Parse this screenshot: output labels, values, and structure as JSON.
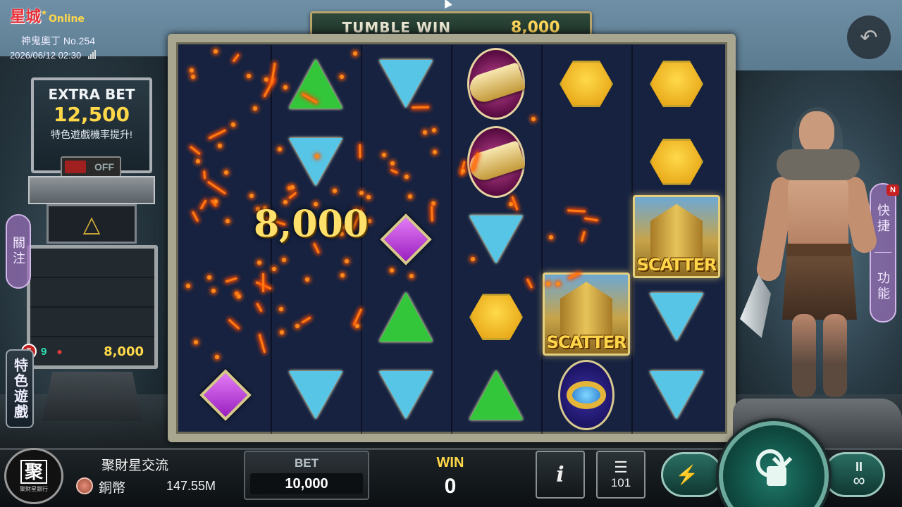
{
  "brand": {
    "logo_text": "星城",
    "online_text": "Online"
  },
  "game": {
    "name": "神鬼奧丁 No.254",
    "datetime": "2026/06/12  02:30"
  },
  "tumble": {
    "label": "TUMBLE WIN",
    "value": "8,000"
  },
  "win_amount_overlay": "8,000",
  "extra_bet": {
    "title": "EXTRA BET",
    "value": "12,500",
    "desc": "特色遊戲機率提升!",
    "toggle": "OFF"
  },
  "free_game": {
    "badge": "5",
    "count": "9",
    "value": "8,000"
  },
  "side_tabs": {
    "left": "關注",
    "special": "特色遊戲",
    "right_top": "快捷",
    "right_bottom": "功能",
    "new_badge": "N"
  },
  "reels": {
    "columns": [
      [
        "empty",
        "empty",
        "empty",
        "empty",
        "gem-purple"
      ],
      [
        "tri-green",
        "tri-blue",
        "empty",
        "empty",
        "tri-blue"
      ],
      [
        "tri-blue",
        "empty",
        "gem-purple",
        "tri-green",
        "tri-blue"
      ],
      [
        "horn",
        "horn",
        "tri-blue",
        "hex-gold",
        "tri-green"
      ],
      [
        "hex-gold",
        "empty",
        "empty",
        "scatter",
        "ring"
      ],
      [
        "hex-gold",
        "hex-gold",
        "scatter",
        "tri-blue",
        "tri-blue"
      ]
    ],
    "scatter_label": "SCATTER"
  },
  "player": {
    "name": "聚財星交流",
    "coin_label": "銅幣",
    "coin_value": "147.55M"
  },
  "agent_logo": {
    "big": "聚",
    "small": "聚財星銀行"
  },
  "bet": {
    "label": "BET",
    "value": "10,000"
  },
  "win": {
    "label": "WIN",
    "value": "0"
  },
  "buttons": {
    "info": "i",
    "history_count": "101",
    "auto_pause": "II",
    "auto_infinity": "∞",
    "turbo": "⚡"
  },
  "colors": {
    "gold": "#ffd84a",
    "teal": "#1f7a6a",
    "reel_bg": "#162240"
  }
}
